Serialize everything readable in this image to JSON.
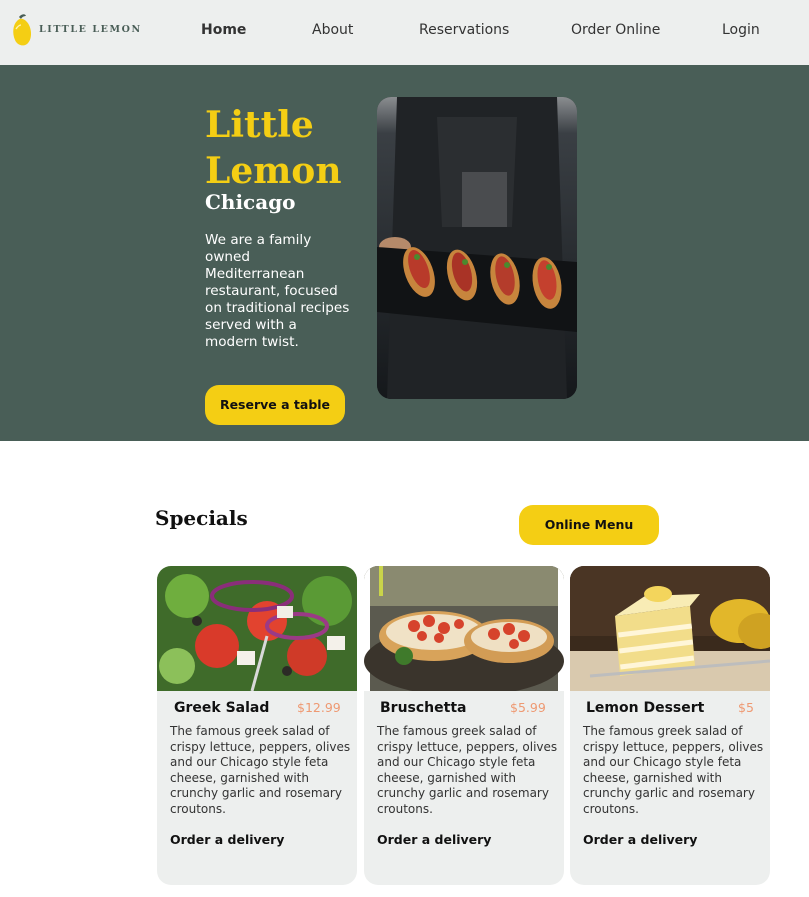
{
  "nav": {
    "logo_text": "LITTLE LEMON",
    "links": [
      {
        "label": "Home",
        "active": true
      },
      {
        "label": "About"
      },
      {
        "label": "Reservations"
      },
      {
        "label": "Order Online"
      },
      {
        "label": "Login"
      }
    ]
  },
  "hero": {
    "title": "Little Lemon",
    "subtitle": "Chicago",
    "description": "We are a family owned Mediterranean restaurant, focused on traditional recipes served with a modern twist.",
    "cta_label": "Reserve a table"
  },
  "specials": {
    "title": "Specials",
    "menu_button_label": "Online Menu",
    "cards": [
      {
        "name": "Greek Salad",
        "price": "$12.99",
        "description": "The famous greek salad of crispy lettuce, peppers, olives and our Chicago style feta cheese, garnished with crunchy garlic and rosemary croutons.",
        "order_label": "Order a delivery"
      },
      {
        "name": "Bruschetta",
        "price": "$5.99",
        "description": "The famous greek salad of crispy lettuce, peppers, olives and our Chicago style feta cheese, garnished with crunchy garlic and rosemary croutons.",
        "order_label": "Order a delivery"
      },
      {
        "name": "Lemon Dessert",
        "price": "$5",
        "description": "The famous greek salad of crispy lettuce, peppers, olives and our Chicago style feta cheese, garnished with crunchy garlic and rosemary croutons.",
        "order_label": "Order a delivery"
      }
    ]
  },
  "colors": {
    "primary_green": "#495e57",
    "primary_yellow": "#f4ce14",
    "price_orange": "#ee9972",
    "card_bg": "#edefee"
  }
}
